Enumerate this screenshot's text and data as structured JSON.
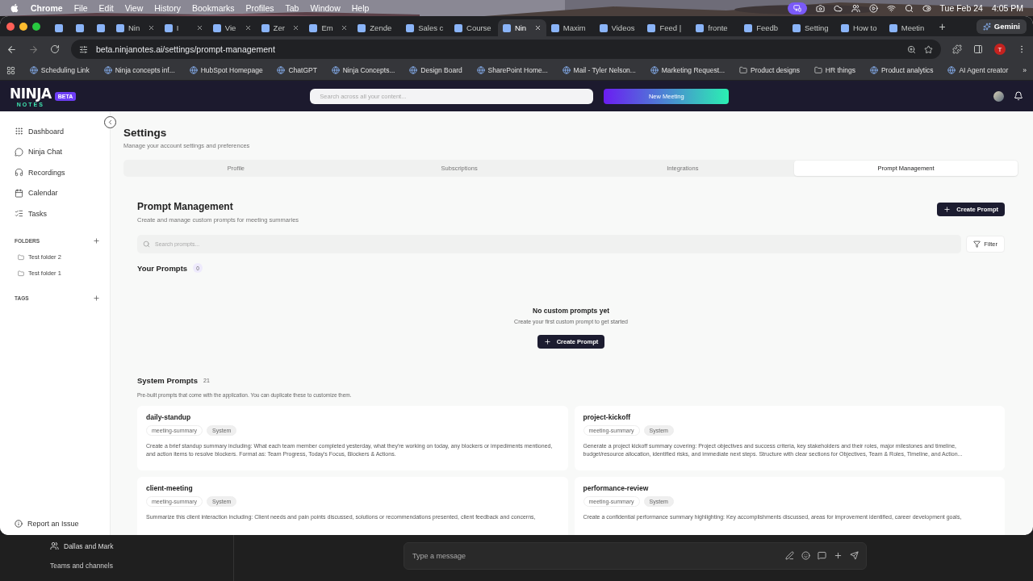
{
  "menu_bar": {
    "app_name": "Chrome",
    "menus": [
      "File",
      "Edit",
      "View",
      "History",
      "Bookmarks",
      "Profiles",
      "Tab",
      "Window",
      "Help"
    ],
    "date": "Tue Feb 24",
    "time": "4:05 PM"
  },
  "browser": {
    "tabs": [
      {
        "kind": "pinned",
        "selected": false
      },
      {
        "kind": "pinned",
        "selected": false
      },
      {
        "kind": "pinned",
        "selected": false
      },
      {
        "kind": "page",
        "title": "Nin",
        "close_button": true,
        "selected": false
      },
      {
        "kind": "page",
        "title": "I",
        "close_button": true,
        "selected": false
      },
      {
        "kind": "page",
        "title": "Vie",
        "close_button": true,
        "selected": false
      },
      {
        "kind": "page",
        "title": "Zer",
        "close_button": true,
        "selected": false
      },
      {
        "kind": "page",
        "title": "Em",
        "close_button": true,
        "selected": false
      },
      {
        "kind": "page",
        "title": "Zende",
        "close_button": false,
        "selected": false
      },
      {
        "kind": "page",
        "title": "Sales c",
        "close_button": false,
        "selected": false
      },
      {
        "kind": "page",
        "title": "Course",
        "close_button": false,
        "selected": false
      },
      {
        "kind": "page",
        "title": "Nin",
        "close_button": true,
        "selected": true
      },
      {
        "kind": "page",
        "title": "Maxim",
        "close_button": false,
        "selected": false
      },
      {
        "kind": "page",
        "title": "Videos",
        "close_button": false,
        "selected": false
      },
      {
        "kind": "page",
        "title": "Feed |",
        "close_button": false,
        "selected": false
      },
      {
        "kind": "page",
        "title": "fronte",
        "close_button": false,
        "selected": false
      },
      {
        "kind": "page",
        "title": "Feedb",
        "close_button": false,
        "selected": false
      },
      {
        "kind": "page",
        "title": "Setting",
        "close_button": false,
        "selected": false
      },
      {
        "kind": "page",
        "title": "How to",
        "close_button": false,
        "selected": false
      },
      {
        "kind": "page",
        "title": "Meetin",
        "close_button": false,
        "selected": false
      }
    ],
    "new_tab": "+",
    "gemini": "Gemini",
    "url": "beta.ninjanotes.ai/settings/prompt-management",
    "profile_initial": "T",
    "bookmarks": [
      {
        "kind": "site",
        "label": "Scheduling Link"
      },
      {
        "kind": "site",
        "label": "Ninja concepts inf..."
      },
      {
        "kind": "site",
        "label": "HubSpot Homepage"
      },
      {
        "kind": "site",
        "label": "ChatGPT"
      },
      {
        "kind": "site",
        "label": "Ninja Concepts..."
      },
      {
        "kind": "site",
        "label": "Design Board"
      },
      {
        "kind": "site",
        "label": "SharePoint Home..."
      },
      {
        "kind": "site",
        "label": "Mail - Tyler Nelson..."
      },
      {
        "kind": "site",
        "label": "Marketing Request..."
      },
      {
        "kind": "folder",
        "label": "Product designs"
      },
      {
        "kind": "folder",
        "label": "HR things"
      },
      {
        "kind": "site",
        "label": "Product analytics"
      },
      {
        "kind": "site",
        "label": "AI Agent creator"
      }
    ],
    "more_bookmarks": "»"
  },
  "app": {
    "logo_word": "NINJA",
    "logo_sub": "NOTES",
    "beta_badge": "BETA",
    "search_placeholder": "Search across all your content...",
    "new_meeting": "New Meeting",
    "sidebar": {
      "nav": [
        {
          "kind": "dashboard",
          "label": "Dashboard"
        },
        {
          "kind": "chat",
          "label": "Ninja Chat"
        },
        {
          "kind": "recordings",
          "label": "Recordings"
        },
        {
          "kind": "calendar",
          "label": "Calendar"
        },
        {
          "kind": "tasks",
          "label": "Tasks"
        }
      ],
      "folders_heading": "FOLDERS",
      "folders": [
        "Test folder 2",
        "Test folder 1"
      ],
      "tags_heading": "TAGS",
      "report": "Report an Issue"
    },
    "settings": {
      "title": "Settings",
      "subtitle": "Manage your account settings and preferences",
      "tabs": [
        {
          "label": "Profile",
          "selected": false
        },
        {
          "label": "Subscriptions",
          "selected": false
        },
        {
          "label": "Integrations",
          "selected": false
        },
        {
          "label": "Prompt Management",
          "selected": true
        }
      ],
      "prompt_management": {
        "title": "Prompt Management",
        "subtitle": "Create and manage custom prompts for meeting summaries",
        "create_button": "Create Prompt",
        "search_placeholder": "Search prompts...",
        "filter": "Filter",
        "your_prompts": {
          "title": "Your Prompts",
          "count": "0",
          "empty_title": "No custom prompts yet",
          "empty_text": "Create your first custom prompt to get started",
          "create_button": "Create Prompt"
        },
        "system_prompts": {
          "title": "System Prompts",
          "count": "21",
          "description": "Pre-built prompts that come with the application. You can duplicate these to customize them.",
          "cards": [
            {
              "name": "daily-standup",
              "tags": [
                "meeting-summary",
                "System"
              ],
              "description": "Create a brief standup summary including: What each team member completed yesterday, what they're working on today, any blockers or impediments mentioned, and action items to resolve blockers. Format as: Team Progress, Today's Focus, Blockers & Actions."
            },
            {
              "name": "project-kickoff",
              "tags": [
                "meeting-summary",
                "System"
              ],
              "description": "Generate a project kickoff summary covering: Project objectives and success criteria, key stakeholders and their roles, major milestones and timeline, budget/resource allocation, identified risks, and immediate next steps. Structure with clear sections for Objectives, Team & Roles, Timeline, and Action..."
            },
            {
              "name": "client-meeting",
              "tags": [
                "meeting-summary",
                "System"
              ],
              "description": "Summarize this client interaction including: Client needs and pain points discussed, solutions or recommendations presented, client feedback and concerns,"
            },
            {
              "name": "performance-review",
              "tags": [
                "meeting-summary",
                "System"
              ],
              "description": "Create a confidential performance summary highlighting: Key accomplishments discussed, areas for improvement identified, career development goals,"
            }
          ]
        }
      }
    }
  },
  "teams": {
    "chat_name": "Dallas and Mark",
    "teams_link": "Teams and channels",
    "message_placeholder": "Type a message"
  }
}
